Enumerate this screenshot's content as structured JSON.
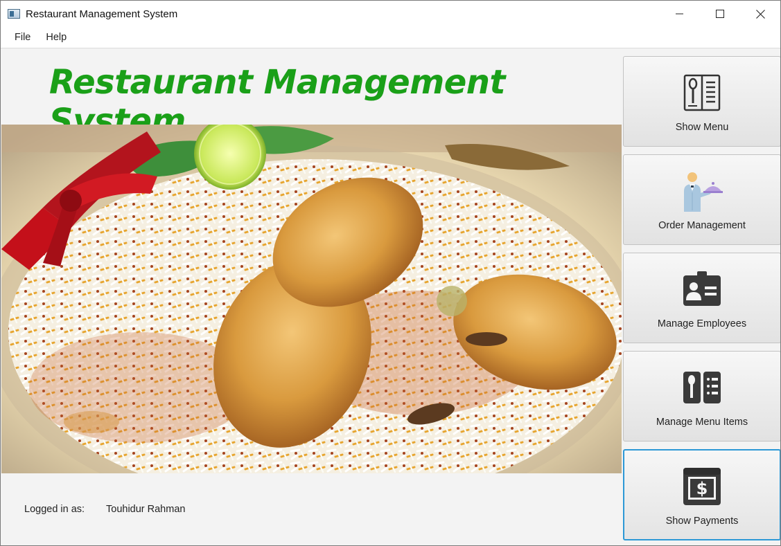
{
  "window": {
    "title": "Restaurant Management System",
    "controls": [
      "minimize-icon",
      "maximize-icon",
      "close-icon"
    ]
  },
  "menubar": {
    "items": [
      {
        "label": "File"
      },
      {
        "label": "Help"
      }
    ]
  },
  "main": {
    "heading": "Restaurant Management System",
    "heading_color": "#1aa018",
    "hero_image": "biryani-dish-photo",
    "logged_in_label": "Logged in as:",
    "logged_in_user": "Touhidur Rahman"
  },
  "sidebar": {
    "buttons": [
      {
        "label": "Show Menu",
        "icon": "menu-book-icon"
      },
      {
        "label": "Order Management",
        "icon": "waiter-icon"
      },
      {
        "label": "Manage Employees",
        "icon": "id-card-icon"
      },
      {
        "label": "Manage Menu Items",
        "icon": "menu-items-icon"
      },
      {
        "label": "Show Payments",
        "icon": "payment-icon",
        "focused": true
      }
    ],
    "focus_color": "#2c98d6"
  }
}
